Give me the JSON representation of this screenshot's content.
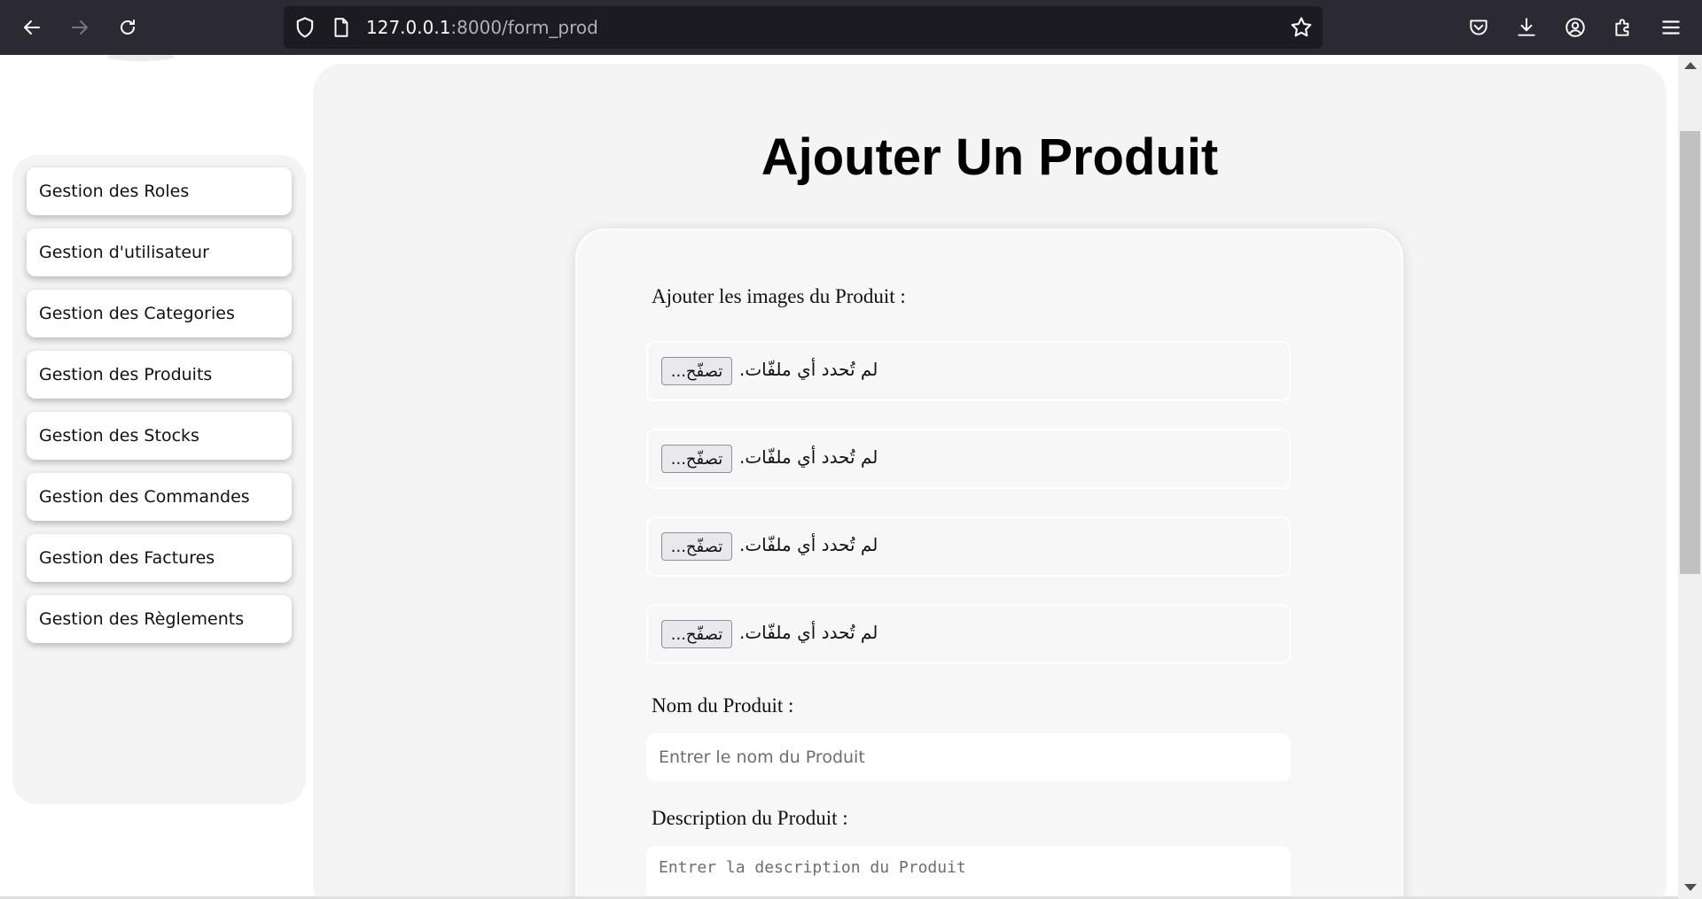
{
  "browser": {
    "url_host": "127.0.0.1",
    "url_rest": ":8000/form_prod",
    "icons": [
      "back-icon",
      "forward-icon",
      "reload-icon",
      "shield-icon",
      "page-icon",
      "bookmark-star-icon",
      "pocket-icon",
      "download-icon",
      "account-icon",
      "extensions-icon",
      "menu-icon"
    ]
  },
  "sidebar": {
    "items": [
      {
        "label": "Gestion des Roles"
      },
      {
        "label": "Gestion d'utilisateur"
      },
      {
        "label": "Gestion des Categories"
      },
      {
        "label": "Gestion des Produits"
      },
      {
        "label": "Gestion des Stocks"
      },
      {
        "label": "Gestion des Commandes"
      },
      {
        "label": "Gestion des Factures"
      },
      {
        "label": "Gestion des Règlements"
      }
    ]
  },
  "main": {
    "title": "Ajouter Un Produit",
    "images_label": "Ajouter les images du Produit :",
    "file_inputs": [
      {
        "button": "تصفّح...",
        "status": "لم تُحدد أي ملفّات."
      },
      {
        "button": "تصفّح...",
        "status": "لم تُحدد أي ملفّات."
      },
      {
        "button": "تصفّح...",
        "status": "لم تُحدد أي ملفّات."
      },
      {
        "button": "تصفّح...",
        "status": "لم تُحدد أي ملفّات."
      }
    ],
    "name_label": "Nom du Produit :",
    "name_placeholder": "Entrer le nom du Produit",
    "description_label": "Description du Produit :",
    "description_placeholder": "Entrer la description du Produit"
  },
  "colors": {
    "toolbar_bg": "#2b2a33",
    "urlbar_bg": "#1c1b22",
    "panel_bg": "#f4f4f4",
    "card_bg": "#f7f7f7"
  }
}
